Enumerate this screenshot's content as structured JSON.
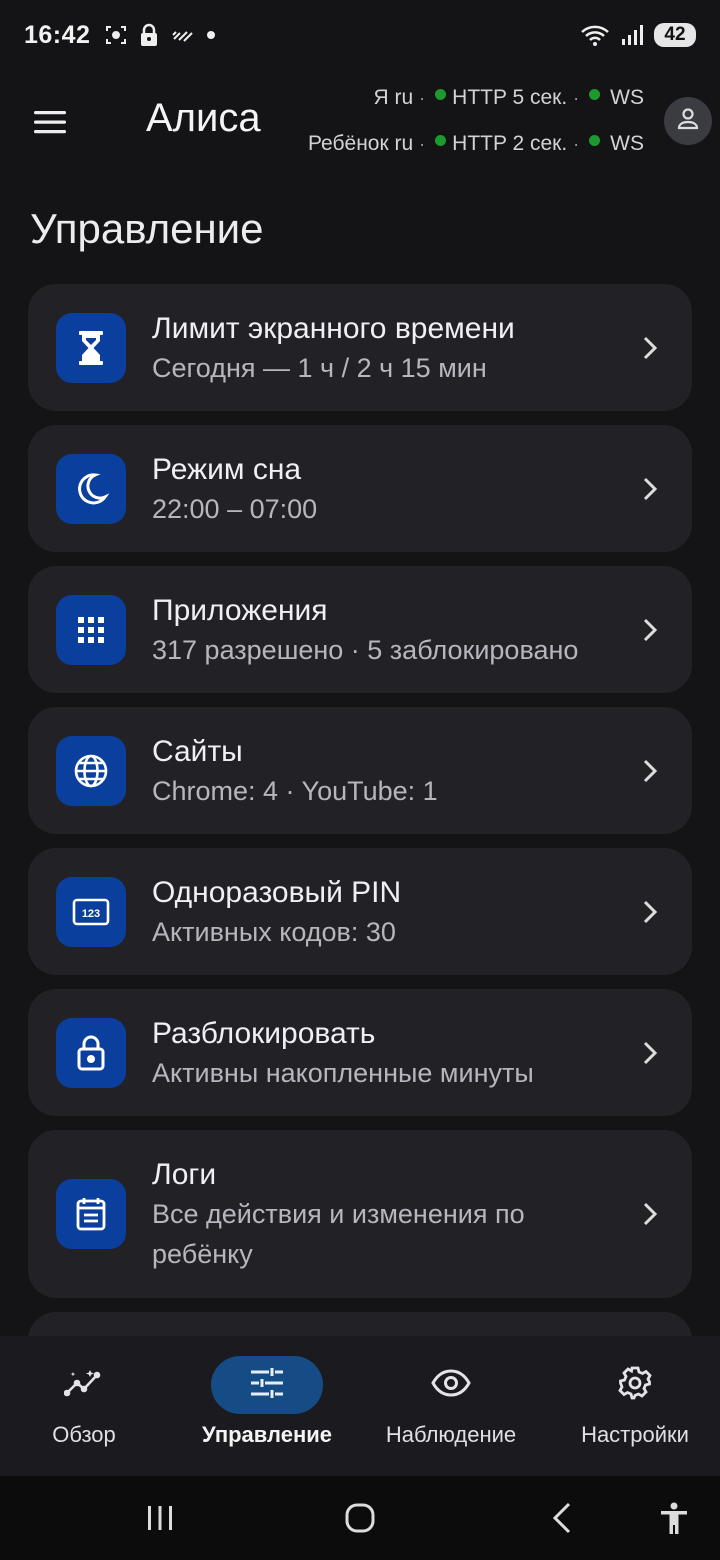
{
  "status_bar": {
    "time": "16:42",
    "battery": "42",
    "icons_left": [
      "screenshot-icon",
      "lock-icon",
      "nfc-icon",
      "dot-icon"
    ],
    "icons_right": [
      "wifi-icon",
      "signal-icon",
      "battery-icon"
    ]
  },
  "app_bar": {
    "title": "Алиса",
    "connections": [
      {
        "name": "Я ru",
        "http": "HTTP 5 сек.",
        "ws": "WS"
      },
      {
        "name": "Ребёнок ru",
        "http": "HTTP 2 сек.",
        "ws": "WS"
      }
    ],
    "separator": "·",
    "status_color": "#1c9a2e",
    "menu_icon": "hamburger-menu-icon",
    "avatar_icon": "person-icon"
  },
  "section_title": "Управление",
  "cards": [
    {
      "title": "Лимит экранного времени",
      "subtitle": "Сегодня — 1 ч / 2 ч 15 мин",
      "icon": "hourglass-icon"
    },
    {
      "title": "Режим сна",
      "subtitle": "22:00 – 07:00",
      "icon": "moon-icon"
    },
    {
      "title": "Приложения",
      "subtitle": "317 разрешено · 5 заблокировано",
      "icon": "apps-grid-icon"
    },
    {
      "title": "Сайты",
      "subtitle": "Chrome: 4 · YouTube: 1",
      "icon": "globe-icon"
    },
    {
      "title": "Одноразовый PIN",
      "subtitle": "Активных кодов: 30",
      "icon": "pin-123-icon"
    },
    {
      "title": "Разблокировать",
      "subtitle": "Активны накопленные минуты",
      "icon": "lock-icon"
    },
    {
      "title": "Логи",
      "subtitle_line1": "Все действия и изменения по",
      "subtitle_line2": "ребёнку",
      "icon": "calendar-log-icon"
    }
  ],
  "bottom_nav": [
    {
      "label": "Обзор",
      "icon": "insights-icon",
      "active": false
    },
    {
      "label": "Управление",
      "icon": "tune-sliders-icon",
      "active": true
    },
    {
      "label": "Наблюдение",
      "icon": "eye-icon",
      "active": false
    },
    {
      "label": "Настройки",
      "icon": "gear-icon",
      "active": false
    }
  ],
  "colors": {
    "background": "#141416",
    "card": "#222226",
    "icon_tile": "#0b3f9e",
    "nav_active": "#164c86"
  }
}
